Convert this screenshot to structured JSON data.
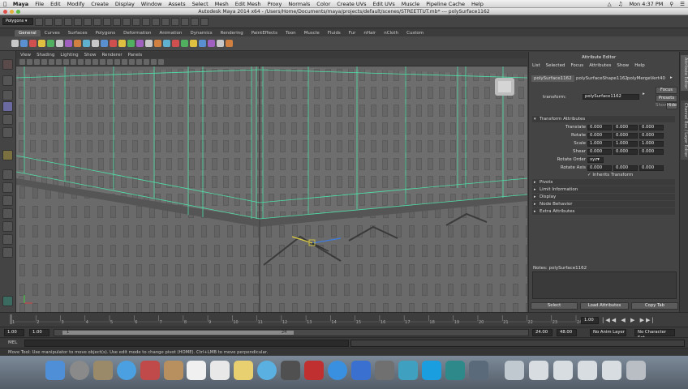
{
  "menubar": {
    "app": "Maya",
    "items": [
      "File",
      "Edit",
      "Modify",
      "Create",
      "Display",
      "Window",
      "Assets",
      "Select",
      "Mesh",
      "Edit Mesh",
      "Proxy",
      "Normals",
      "Color",
      "Create UVs",
      "Edit UVs",
      "Muscle",
      "Pipeline Cache",
      "Help"
    ],
    "clock": "Mon 4:37 PM"
  },
  "window": {
    "title": "Autodesk Maya 2014 x64 - /Users/Home/Documents/maya/projects/default/scenes/STREETTUT.mb* --- polySurface1162"
  },
  "statusline": {
    "menuset": "Polygons"
  },
  "shelf": {
    "tabs": [
      "General",
      "Curves",
      "Surfaces",
      "Polygons",
      "Deformation",
      "Animation",
      "Dynamics",
      "Rendering",
      "PaintEffects",
      "Toon",
      "Muscle",
      "Fluids",
      "Fur",
      "nHair",
      "nCloth",
      "Custom"
    ],
    "active": "General"
  },
  "viewport": {
    "menu": [
      "View",
      "Shading",
      "Lighting",
      "Show",
      "Renderer",
      "Panels"
    ]
  },
  "attribute_editor": {
    "title": "Attribute Editor",
    "menu": [
      "List",
      "Selected",
      "Focus",
      "Attributes",
      "Show",
      "Help"
    ],
    "tabs": [
      "polySurface1162",
      "polySurfaceShape1162",
      "polyMergeVert40"
    ],
    "focus_btn": "Focus",
    "presets_btn": "Presets",
    "show_btn": "Show",
    "hide_btn": "Hide",
    "node_label": "transform:",
    "node_value": "polySurface1162",
    "transform_section": "Transform Attributes",
    "rows": [
      {
        "label": "Translate",
        "values": [
          "0.000",
          "0.000",
          "0.000"
        ]
      },
      {
        "label": "Rotate",
        "values": [
          "0.000",
          "0.000",
          "0.000"
        ]
      },
      {
        "label": "Scale",
        "values": [
          "1.000",
          "1.000",
          "1.000"
        ]
      },
      {
        "label": "Shear",
        "values": [
          "0.000",
          "0.000",
          "0.000"
        ]
      }
    ],
    "rotate_order_label": "Rotate Order",
    "rotate_order_value": "xyz",
    "rotate_axis_label": "Rotate Axis",
    "rotate_axis_values": [
      "0.000",
      "0.000",
      "0.000"
    ],
    "inherits_label": "Inherits Transform",
    "sections": [
      "Pivots",
      "Limit Information",
      "Display",
      "Node Behavior",
      "Extra Attributes"
    ],
    "notes_label": "Notes:  polySurface1162",
    "buttons": [
      "Select",
      "Load Attributes",
      "Copy Tab"
    ]
  },
  "side_tabs": [
    "Attribute Editor",
    "Channel Box / Layer Editor"
  ],
  "timeslider": {
    "ticks": [
      "1",
      "2",
      "3",
      "4",
      "5",
      "6",
      "7",
      "8",
      "9",
      "10",
      "11",
      "12",
      "13",
      "14",
      "15",
      "16",
      "17",
      "18",
      "19",
      "20",
      "21",
      "22",
      "23",
      "24"
    ],
    "current_frame": "1.00"
  },
  "rangeslider": {
    "start": "1.00",
    "start2": "1.00",
    "range_start_label": "1",
    "range_end_label": "24",
    "end": "24.00",
    "end2": "48.00",
    "anim_layer": "No Anim Layer",
    "character_set": "No Character Set"
  },
  "mel": {
    "label": "MEL"
  },
  "helpline": {
    "text": "Move Tool: Use manipulator to move object(s). Use edit mode to change pivot (HOME). Ctrl+LMB to move perpendicular."
  },
  "colors": {
    "wire": "#4fe0a8",
    "maya_bg": "#444444"
  }
}
